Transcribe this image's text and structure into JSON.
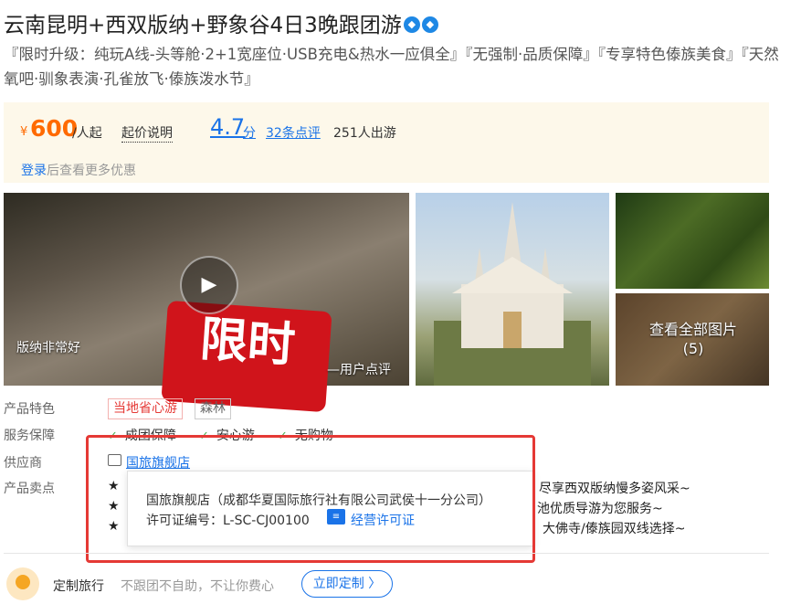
{
  "product": {
    "title": "云南昆明+西双版纳+野象谷4日3晚跟团游",
    "badge_icons": [
      "verified-diamond-icon",
      "verified-diamond-icon"
    ],
    "subtitle": "『限时升级：纯玩A线-头等舱·2+1宽座位·USB充电&热水一应俱全』『无强制·品质保障』『专享特色傣族美食』『天然氧吧·驯象表演·孔雀放飞·傣族泼水节』"
  },
  "pricing": {
    "currency": "¥",
    "price": "600",
    "unit": "/人起",
    "price_note": "起价说明",
    "rating": "4.7",
    "rating_unit": "分",
    "reviews": "32条点评",
    "travelers": "251人出游",
    "login_link": "登录",
    "login_suffix": "后查看更多优惠"
  },
  "gallery": {
    "main_caption_left": "版纳非常好",
    "main_caption_right": "—用户点评",
    "sign_text": "限时",
    "view_all_line1": "查看全部图片",
    "view_all_line2": "(5)"
  },
  "features": {
    "label": "产品特色",
    "tags": [
      {
        "text": "当地省心游",
        "color": "#e53935"
      },
      {
        "text": "森林",
        "color": "#666666"
      }
    ]
  },
  "service": {
    "label": "服务保障",
    "items": [
      "成团保障",
      "安心游",
      "无购物"
    ]
  },
  "supplier": {
    "label": "供应商",
    "name": "国旅旗舰店"
  },
  "selling_points": {
    "label": "产品卖点",
    "items": [
      "尽享西双版纳慢多姿风采~",
      "池优质导游为您服务~",
      "，大佛寺/傣族园双线选择~"
    ]
  },
  "popup": {
    "company": "国旅旗舰店（成都华夏国际旅行社有限公司武侯十一分公司）",
    "license_label": "许可证编号：",
    "license_no": "L-SC-CJ00100",
    "license_link": "经营许可证"
  },
  "custom": {
    "title": "定制旅行",
    "desc": "不跟团不自助，不让你费心",
    "button": "立即定制",
    "button_arrow": "〉"
  }
}
